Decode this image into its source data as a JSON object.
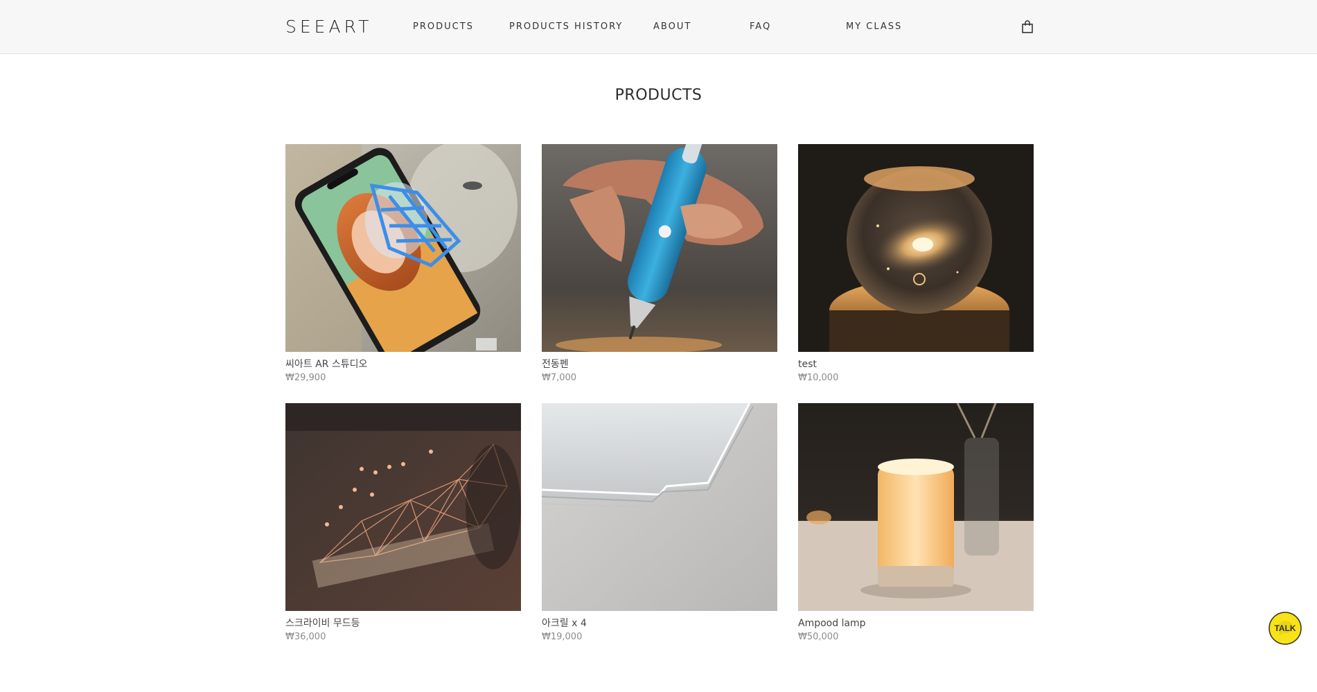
{
  "header": {
    "logo": "SEEART",
    "nav": [
      {
        "label": "PRODUCTS"
      },
      {
        "label": "PRODUCTS HISTORY"
      },
      {
        "label": "ABOUT"
      },
      {
        "label": "FAQ"
      },
      {
        "label": "MY CLASS"
      }
    ],
    "cart_icon": "shopping-bag-icon"
  },
  "main": {
    "title": "PRODUCTS",
    "products": [
      {
        "name": "씨아트 AR 스튜디오",
        "price": "₩29,900",
        "image": "phone-ar-drawing"
      },
      {
        "name": "전동펜",
        "price": "₩7,000",
        "image": "electric-pen"
      },
      {
        "name": "test",
        "price": "₩10,000",
        "image": "galaxy-crystal-ball"
      },
      {
        "name": "스크라이비 무드등",
        "price": "₩36,000",
        "image": "whale-string-art"
      },
      {
        "name": "아크릴 x 4",
        "price": "₩19,000",
        "image": "acrylic-sheets"
      },
      {
        "name": "Ampood lamp",
        "price": "₩50,000",
        "image": "cylinder-lamp"
      }
    ]
  },
  "chat_widget": {
    "label": "TALK",
    "color": "#f7e317"
  }
}
